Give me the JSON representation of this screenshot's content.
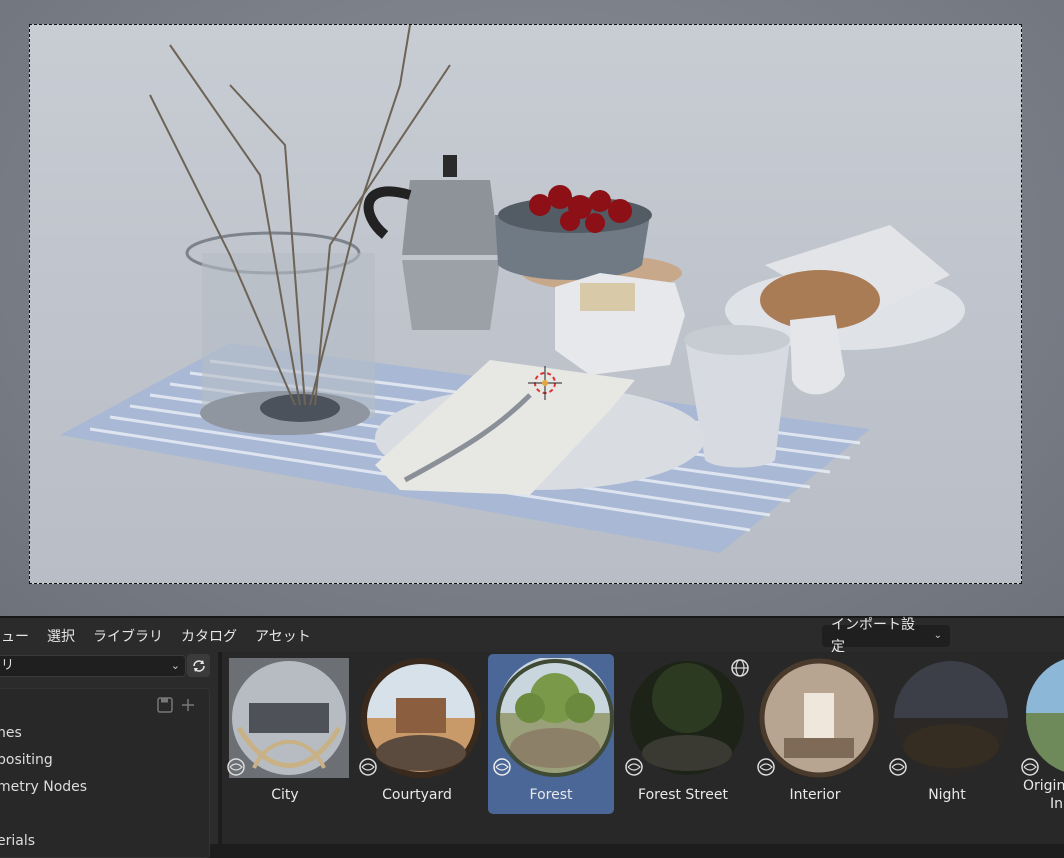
{
  "header": {
    "menu": [
      "ュー",
      "選択",
      "ライブラリ",
      "カタログ",
      "アセット"
    ],
    "import_settings": "インポート設定"
  },
  "left_panel": {
    "library_value": "リ",
    "tree_items": [
      "nes",
      "positing",
      "metry Nodes",
      "erials"
    ]
  },
  "assets": [
    {
      "label": "City",
      "selected": false,
      "icon": "globe-icon"
    },
    {
      "label": "Courtyard",
      "selected": false,
      "icon": "globe-icon"
    },
    {
      "label": "Forest",
      "selected": true,
      "icon": "globe-icon"
    },
    {
      "label": "Forest Street",
      "selected": false,
      "icon": "globe-icon"
    },
    {
      "label": "Interior",
      "selected": false,
      "icon": "globe-icon"
    },
    {
      "label": "Night",
      "selected": false,
      "icon": "globe-icon"
    },
    {
      "label": "Origin",
      "label2": "In",
      "selected": false,
      "icon": "globe-icon"
    }
  ],
  "colors": {
    "selected_tile": "#4a6797",
    "panel_bg": "#282828",
    "header_bg": "#2b2b2b"
  }
}
